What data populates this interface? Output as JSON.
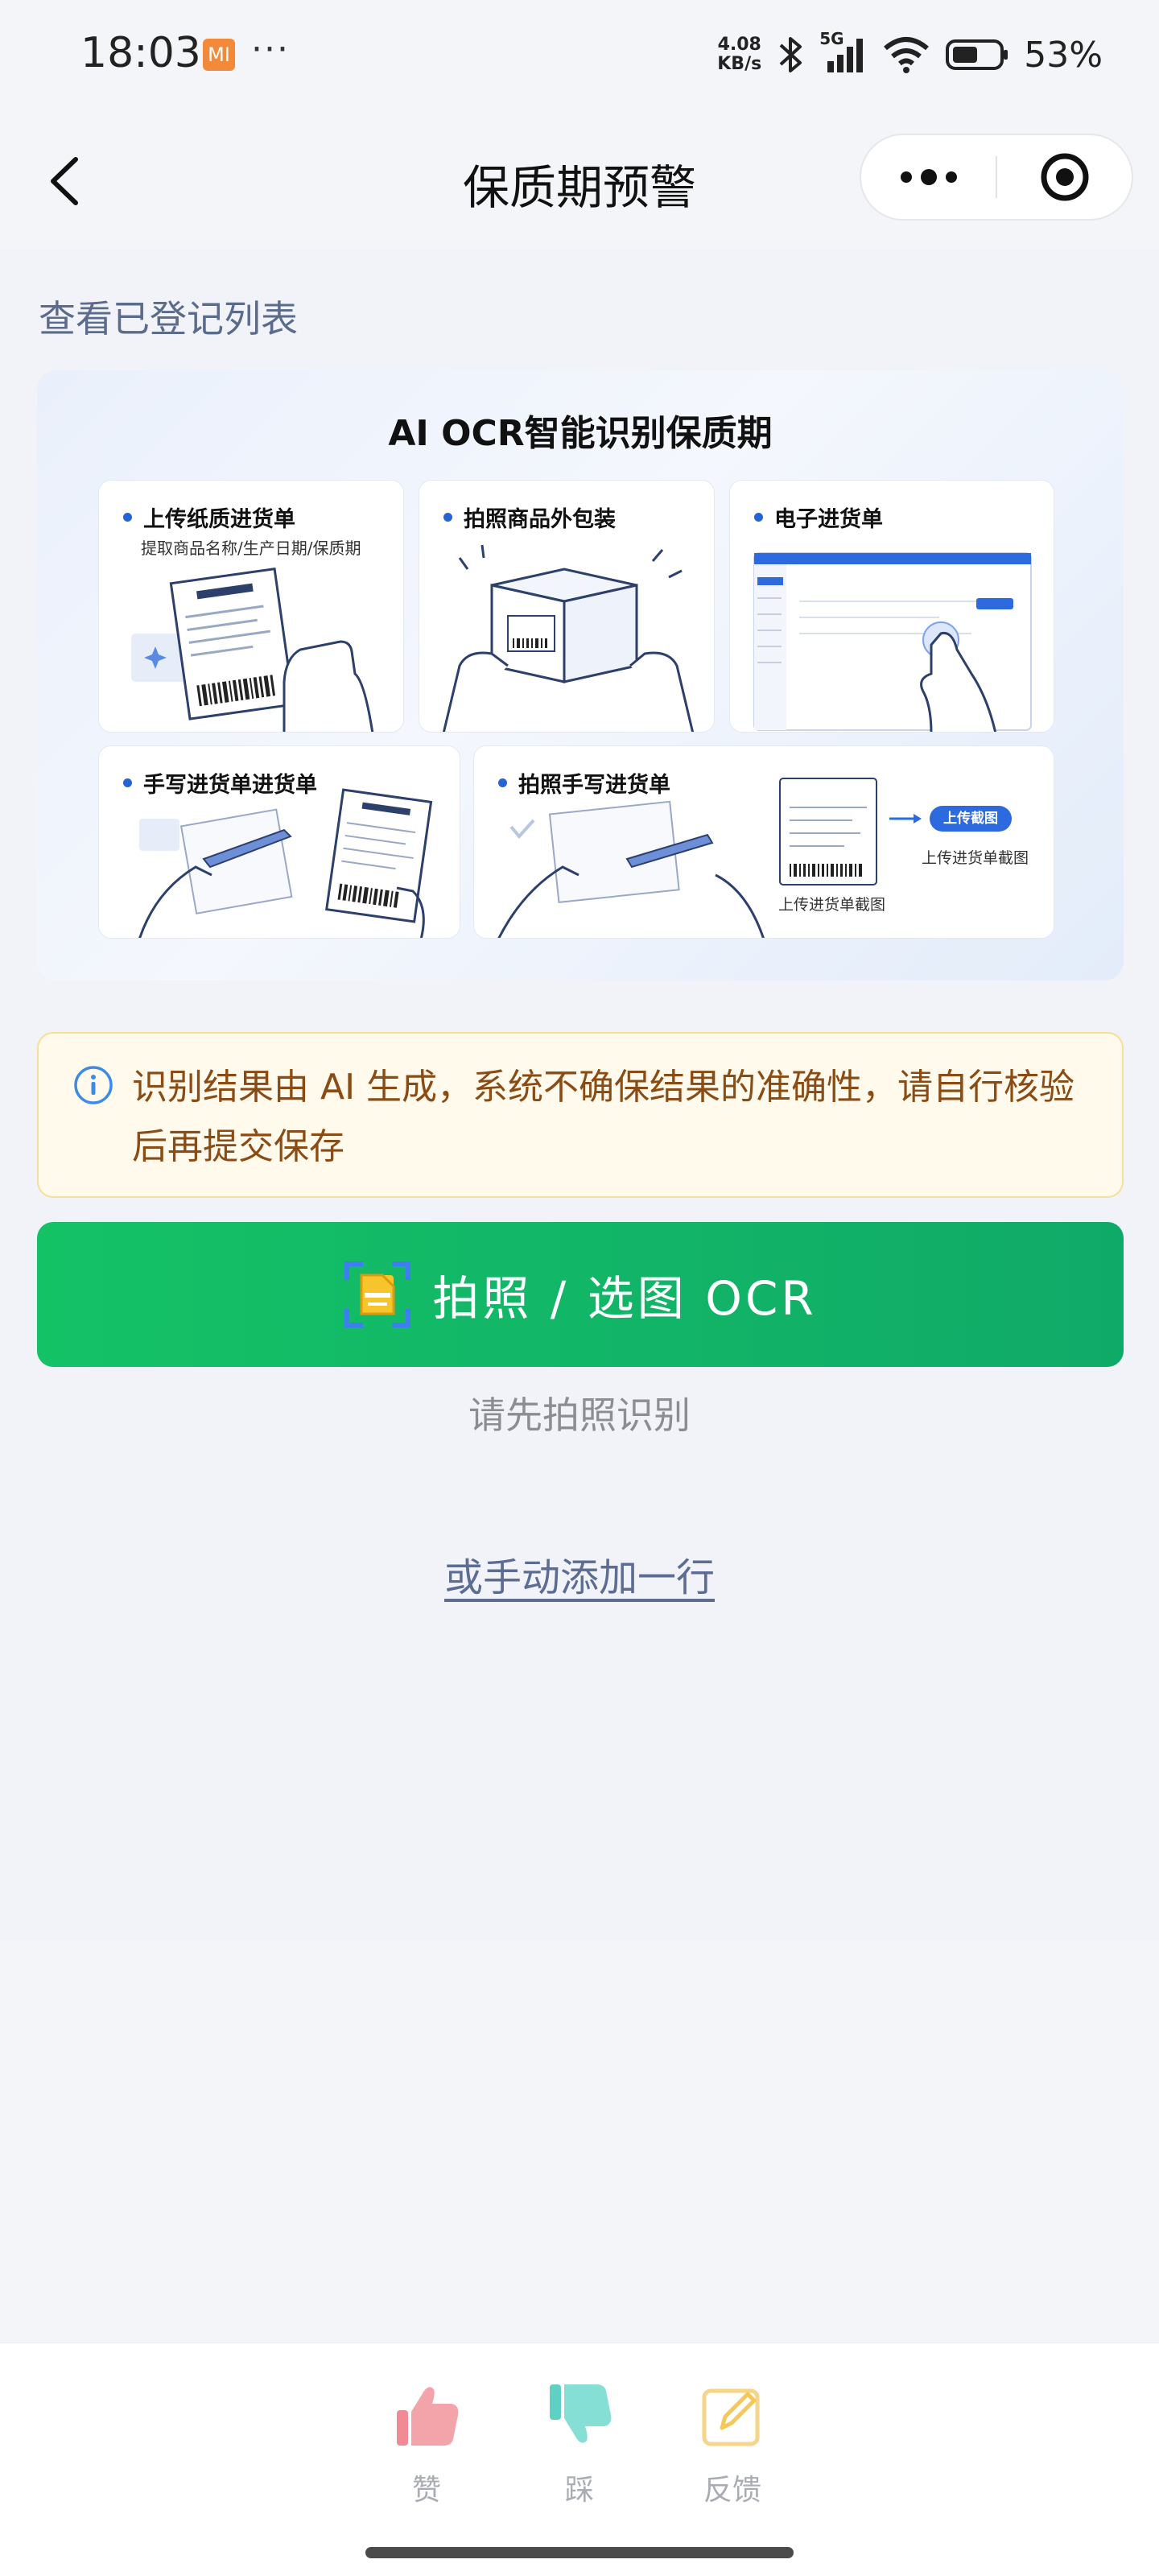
{
  "status_bar": {
    "time": "18:03",
    "app_icon_label": "MI",
    "more": "···",
    "net_speed_value": "4.08",
    "net_speed_unit": "KB/s",
    "network": "5G",
    "battery_percent": "53%"
  },
  "nav": {
    "title": "保质期预警"
  },
  "page": {
    "view_list_link": "查看已登记列表"
  },
  "banner": {
    "title": "AI OCR智能识别保质期",
    "cards": [
      {
        "title": "上传纸质进货单",
        "subtitle": "提取商品名称/生产日期/保质期"
      },
      {
        "title": "拍照商品外包装"
      },
      {
        "title": "电子进货单"
      },
      {
        "title": "手写进货单进货单"
      },
      {
        "title": "拍照手写进货单",
        "upload_btn": "上传截图",
        "caption_left": "上传进货单截图",
        "caption_right": "上传进货单截图"
      }
    ]
  },
  "notice": {
    "text": "识别结果由 AI 生成，系统不确保结果的准确性，请自行核验后再提交保存"
  },
  "ocr_button": {
    "label": "拍照 / 选图 OCR"
  },
  "hint": {
    "text": "请先拍照识别"
  },
  "manual_add": {
    "label": "或手动添加一行"
  },
  "feedback": {
    "like": "赞",
    "dislike": "踩",
    "report": "反馈"
  },
  "colors": {
    "primary_green": "#12b866",
    "notice_bg": "#fffaeb",
    "notice_text": "#8a4b14",
    "link": "#5c6c92",
    "accent_blue": "#2563d8"
  }
}
